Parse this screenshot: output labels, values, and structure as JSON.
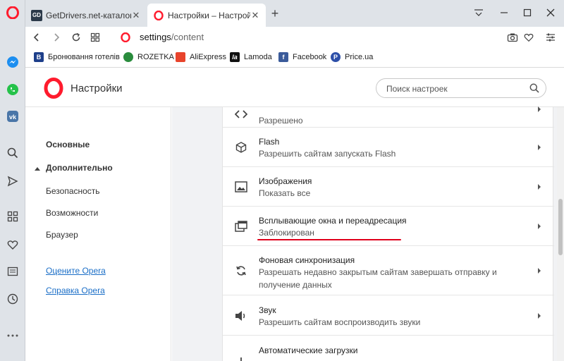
{
  "browser": {
    "tabs": [
      {
        "title": "GetDrivers.net-каталог бес",
        "favicon": "getdrivers-icon",
        "favicon_text": "GD",
        "active": false
      },
      {
        "title": "Настройки – Настройки са",
        "favicon": "opera-settings-icon",
        "active": true
      }
    ],
    "url_main": "settings",
    "url_path": "/content",
    "bookmarks": [
      {
        "label": "Бронювання готелів",
        "icon_text": "B",
        "color": "#1e3f8a"
      },
      {
        "label": "ROZETKA",
        "icon_text": "",
        "color": "#2a8c3d"
      },
      {
        "label": "AliExpress",
        "icon_text": "",
        "color": "#e8442c"
      },
      {
        "label": "Lamoda",
        "icon_text": "la",
        "color": "#111111"
      },
      {
        "label": "Facebook",
        "icon_text": "f",
        "color": "#3b5b9a"
      },
      {
        "label": "Price.ua",
        "icon_text": "P",
        "color": "#2d4fa8"
      }
    ]
  },
  "settings": {
    "title": "Настройки",
    "search_placeholder": "Поиск настроек"
  },
  "nav": {
    "basic": "Основные",
    "advanced": "Дополнительно",
    "items": [
      "Безопасность",
      "Возможности",
      "Браузер"
    ],
    "links": [
      "Оцените Opera",
      "Справка Opera"
    ]
  },
  "content": {
    "rows": [
      {
        "title": "",
        "desc": "Разрешено",
        "icon": "code-icon"
      },
      {
        "title": "Flash",
        "desc": "Разрешить сайтам запускать Flash",
        "icon": "cube-icon"
      },
      {
        "title": "Изображения",
        "desc": "Показать все",
        "icon": "image-icon"
      },
      {
        "title": "Всплывающие окна и переадресация",
        "desc": "Заблокирован",
        "icon": "popup-icon"
      },
      {
        "title": "Фоновая синхронизация",
        "desc": "Разрешать недавно закрытым сайтам завершать отправку и получение данных",
        "icon": "sync-icon"
      },
      {
        "title": "Звук",
        "desc": "Разрешить сайтам воспроизводить звуки",
        "icon": "speaker-icon"
      },
      {
        "title": "Автоматические загрузки",
        "desc": "",
        "icon": "download-icon"
      }
    ]
  },
  "colors": {
    "opera_red": "#ff1b2d",
    "highlight_underline": "#e0001b",
    "link": "#1a6ec7"
  }
}
